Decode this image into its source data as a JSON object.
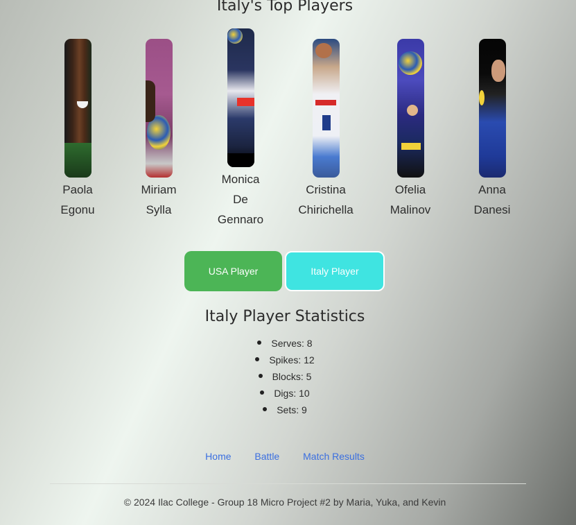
{
  "page": {
    "title": "Italy's Top Players"
  },
  "players": [
    {
      "first": "Paola",
      "last": "Egonu"
    },
    {
      "first": "Miriam",
      "last": "Sylla"
    },
    {
      "first": "Monica",
      "middle": "De",
      "last": "Gennaro"
    },
    {
      "first": "Cristina",
      "last": "Chirichella"
    },
    {
      "first": "Ofelia",
      "last": "Malinov"
    },
    {
      "first": "Anna",
      "last": "Danesi"
    }
  ],
  "toggle": {
    "usa_label": "USA Player",
    "italy_label": "Italy Player",
    "usa_color": "#4cb556",
    "italy_color": "#3fe4e1"
  },
  "stats": {
    "title": "Italy Player Statistics",
    "items": [
      "Serves: 8",
      "Spikes: 12",
      "Blocks: 5",
      "Digs: 10",
      "Sets: 9"
    ]
  },
  "nav": {
    "home": "Home",
    "battle": "Battle",
    "match_results": "Match Results"
  },
  "footer": {
    "text": "© 2024 Ilac College - Group 18 Micro Project #2 by Maria, Yuka, and Kevin"
  }
}
